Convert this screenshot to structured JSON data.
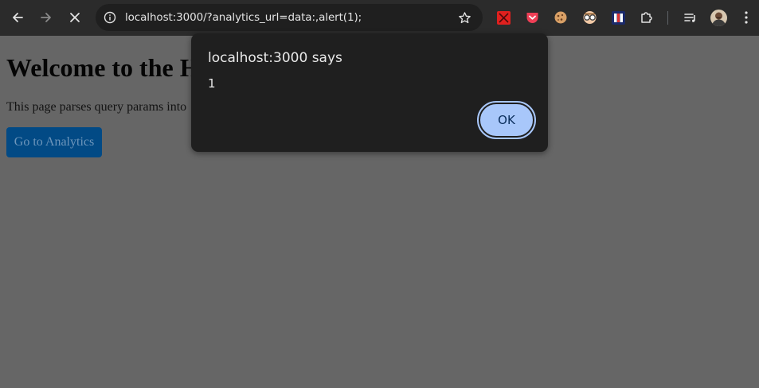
{
  "browser": {
    "url": "localhost:3000/?analytics_url=data:,alert(1);",
    "colors": {
      "toolbar": "#2b2b2b",
      "omnibox": "#1f1f1f",
      "icon": "#e3e3e3"
    }
  },
  "page": {
    "title": "Welcome to the H",
    "description": "This page parses query params into",
    "button_label": "Go to Analytics",
    "colors": {
      "background": "#666666",
      "button": "#024a85"
    }
  },
  "dialog": {
    "title": "localhost:3000 says",
    "message": "1",
    "ok_label": "OK",
    "colors": {
      "background": "#1f1f1f",
      "button": "#a8c7fa"
    }
  }
}
